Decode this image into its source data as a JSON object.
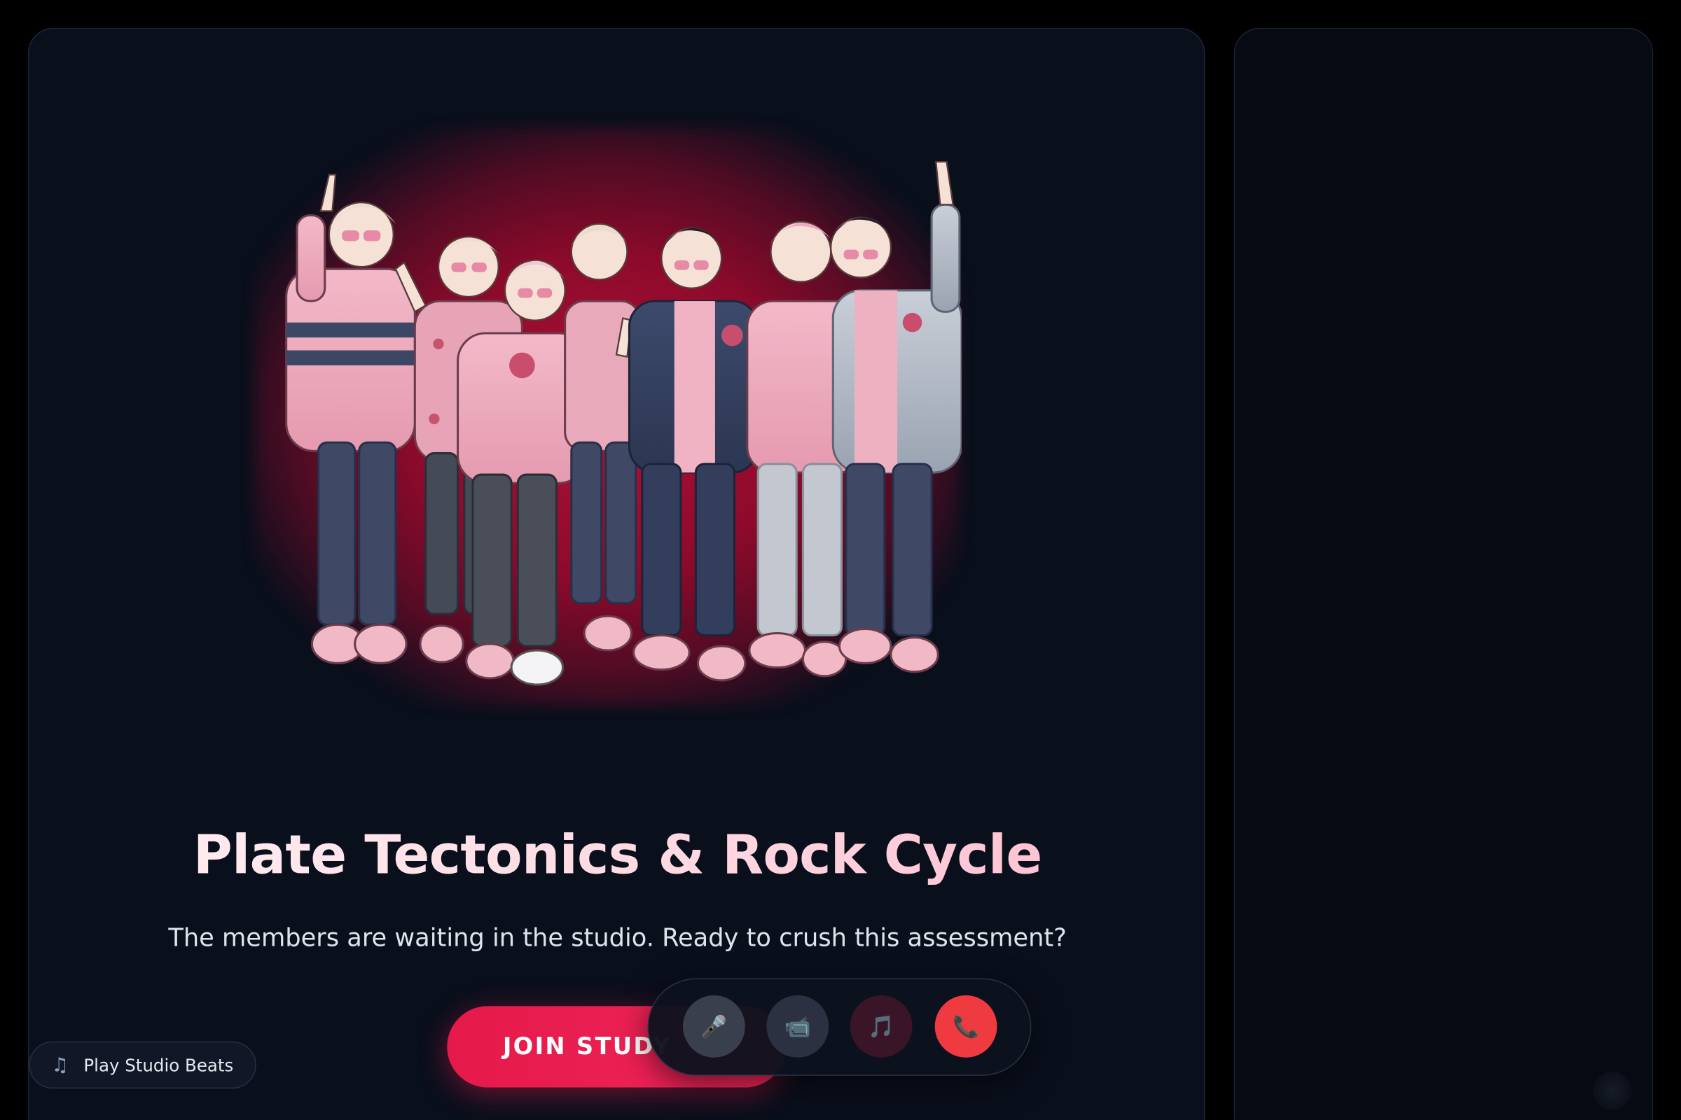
{
  "study": {
    "title": "Plate Tectonics & Rock Cycle",
    "subtitle": "The members are waiting in the studio. Ready to crush this assessment?",
    "join_label": "JOIN STUDY"
  },
  "beats": {
    "icon": "music-note-icon",
    "label": "Play Studio Beats"
  },
  "call_controls": {
    "mic_icon": "🎤",
    "camera_icon": "📹",
    "music_icon": "🎵",
    "end_call_icon": "📞"
  },
  "colors": {
    "accent": "#e5194a",
    "end_call": "#ef3a40",
    "panel_bg": "#0a0f1c",
    "hero_glow": "#b01038"
  }
}
